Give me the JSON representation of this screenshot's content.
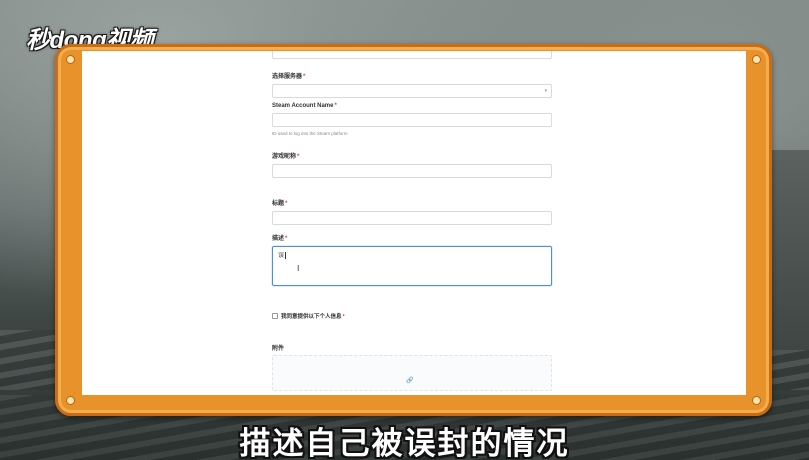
{
  "logo": {
    "text": "秒dong视频"
  },
  "subtitle": "描述自己被误封的情况",
  "form": {
    "server": {
      "label": "选择服务器",
      "caret": "▾"
    },
    "steam_account": {
      "label": "Steam Account Name",
      "hint": "ID used to log into the Steam platform"
    },
    "game_nickname": {
      "label": "游戏昵称",
      "hint": ""
    },
    "title": {
      "label": "标题"
    },
    "description": {
      "label": "描述",
      "value": "误",
      "hint": ""
    },
    "privacy": {
      "label": "我同意提供以下个人信息",
      "desc": ""
    },
    "attachment": {
      "label": "附件",
      "link": "",
      "text": ""
    },
    "required_mark": "*"
  },
  "colors": {
    "frame": "#e8922c",
    "focus": "#4a90d9",
    "required": "#e0443e"
  }
}
